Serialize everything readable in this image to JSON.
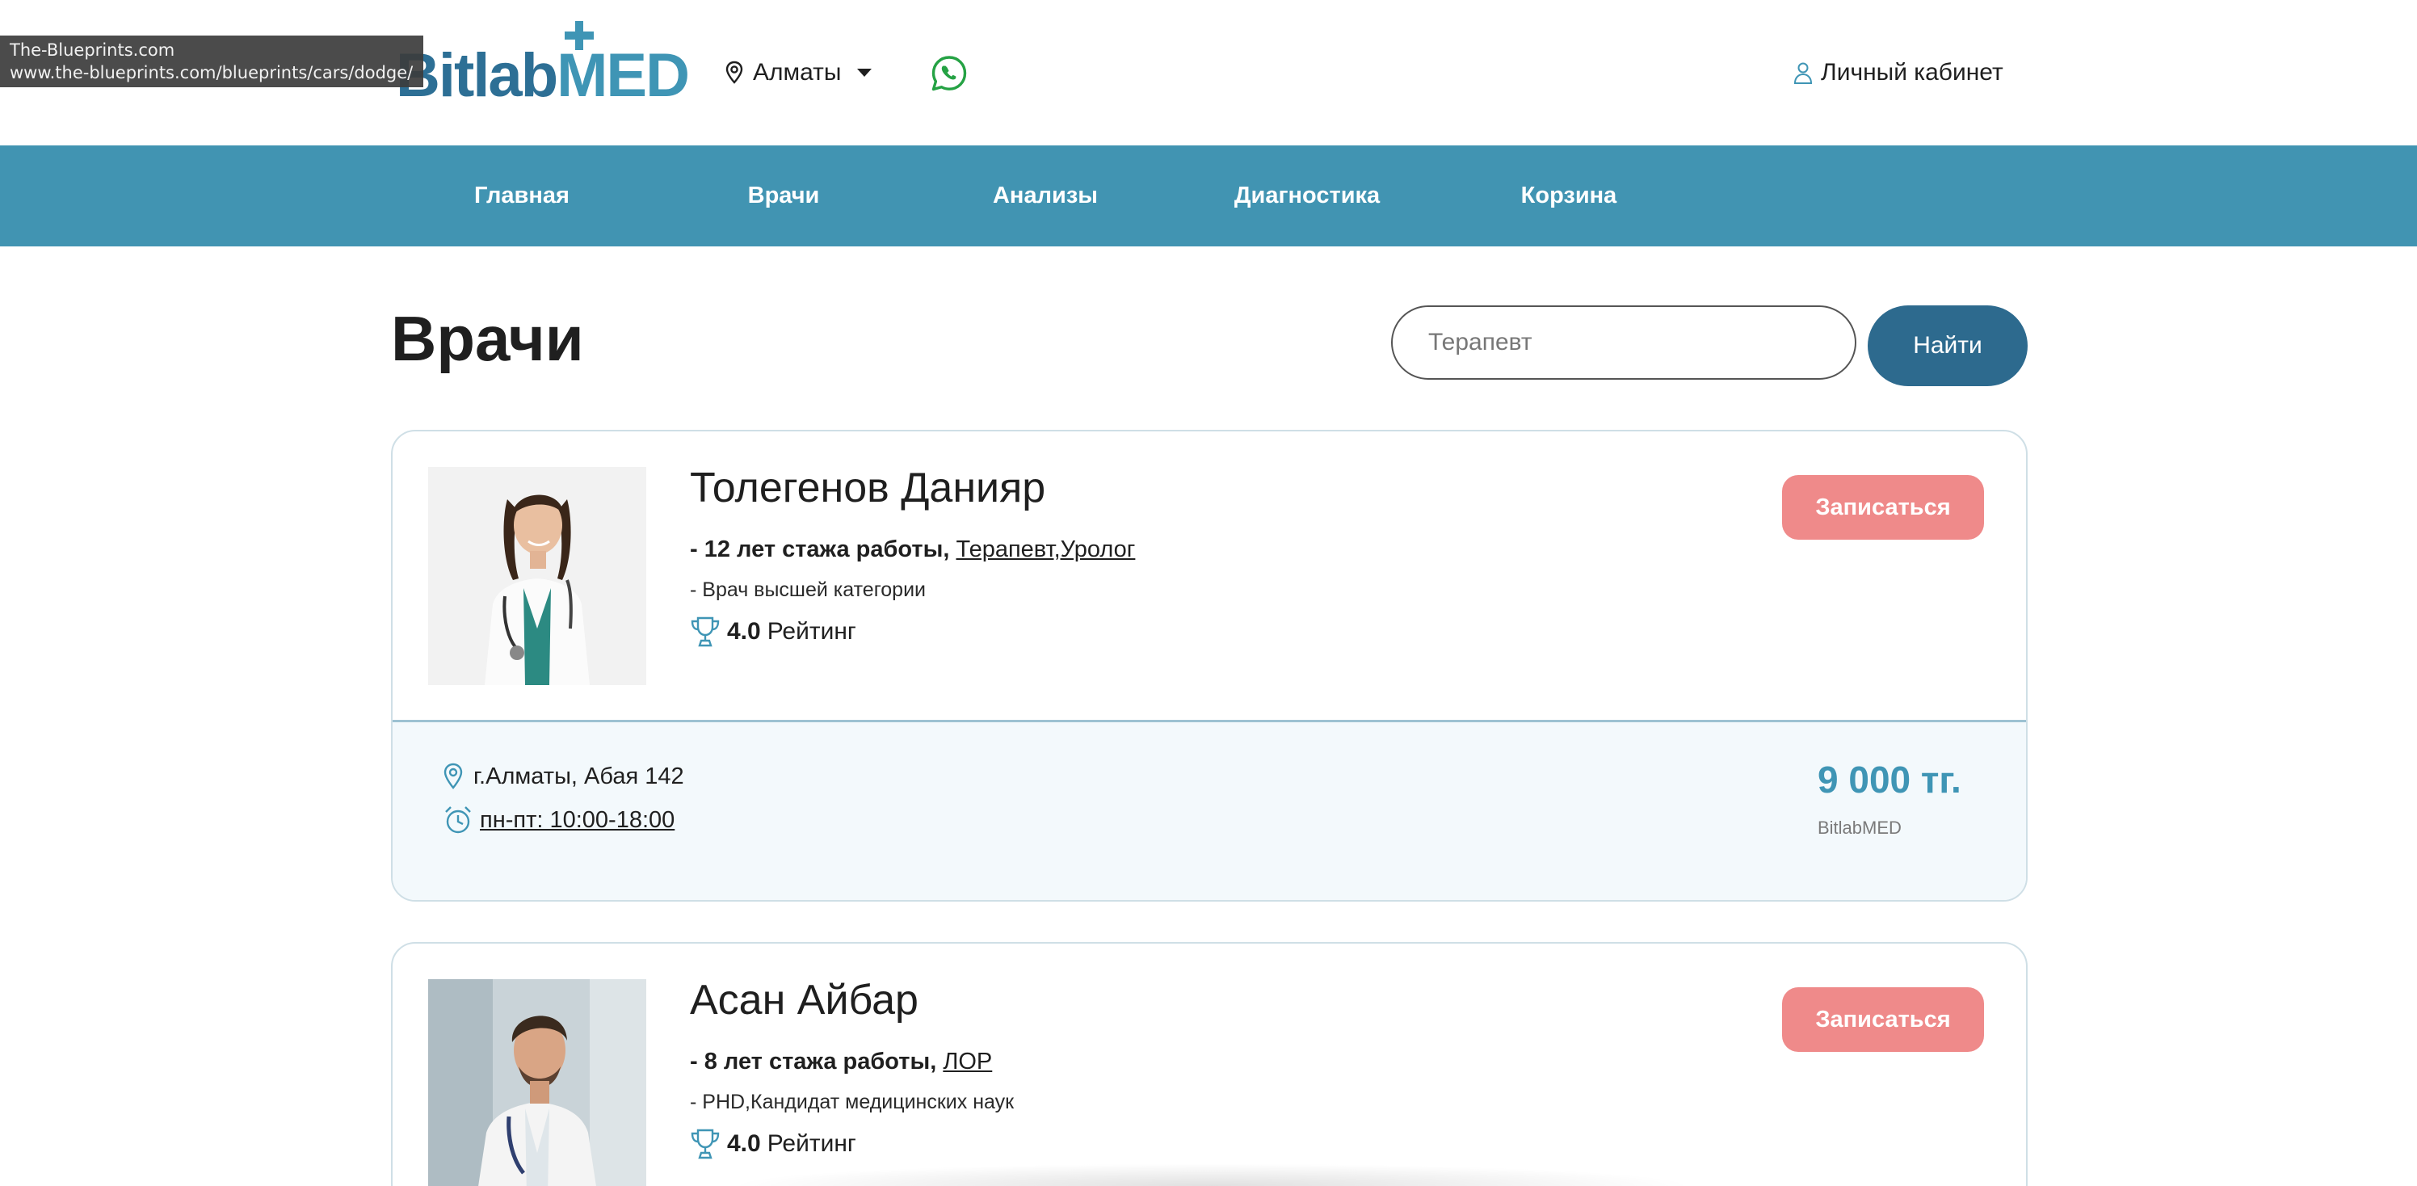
{
  "header": {
    "logo_part1": "Bitlab",
    "logo_part2": "MED",
    "city": "Алматы",
    "account_label": "Личный кабинет"
  },
  "tooltip": {
    "line1": "The-Blueprints.com",
    "line2": "www.the-blueprints.com/blueprints/cars/dodge/"
  },
  "nav": {
    "items": [
      "Главная",
      "Врачи",
      "Анализы",
      "Диагностика",
      "Корзина"
    ]
  },
  "main": {
    "title": "Врачи",
    "search": {
      "value": "",
      "placeholder": "Терапевт",
      "button_label": "Найти"
    }
  },
  "doctors": [
    {
      "name": "Толегенов Данияр",
      "experience": "- 12 лет стажа работы,",
      "specialties": "Терапевт,Уролог",
      "category": "- Врач высшей категории",
      "rating_value": "4.0",
      "rating_label": "Рейтинг",
      "book_label": "Записаться",
      "address": "г.Алматы, Абая 142",
      "hours": " пн-пт: 10:00-18:00",
      "price": "9 000 тг.",
      "clinic": "BitlabMED"
    },
    {
      "name": "Асан Айбар",
      "experience": "- 8 лет стажа работы,",
      "specialties": "ЛОР",
      "category": "- PHD,Кандидат медицинских наук",
      "rating_value": "4.0",
      "rating_label": "Рейтинг",
      "book_label": "Записаться"
    }
  ],
  "colors": {
    "primary": "#4194b2",
    "dark_blue": "#2d6a8e",
    "book_button": "#ef8a8a",
    "price": "#3f95b5",
    "whatsapp": "#25a244"
  },
  "icons": {
    "city": "map-pin-icon",
    "whatsapp": "whatsapp-icon",
    "account": "user-icon",
    "rating": "trophy-icon",
    "address": "map-pin-icon",
    "hours": "alarm-clock-icon"
  }
}
